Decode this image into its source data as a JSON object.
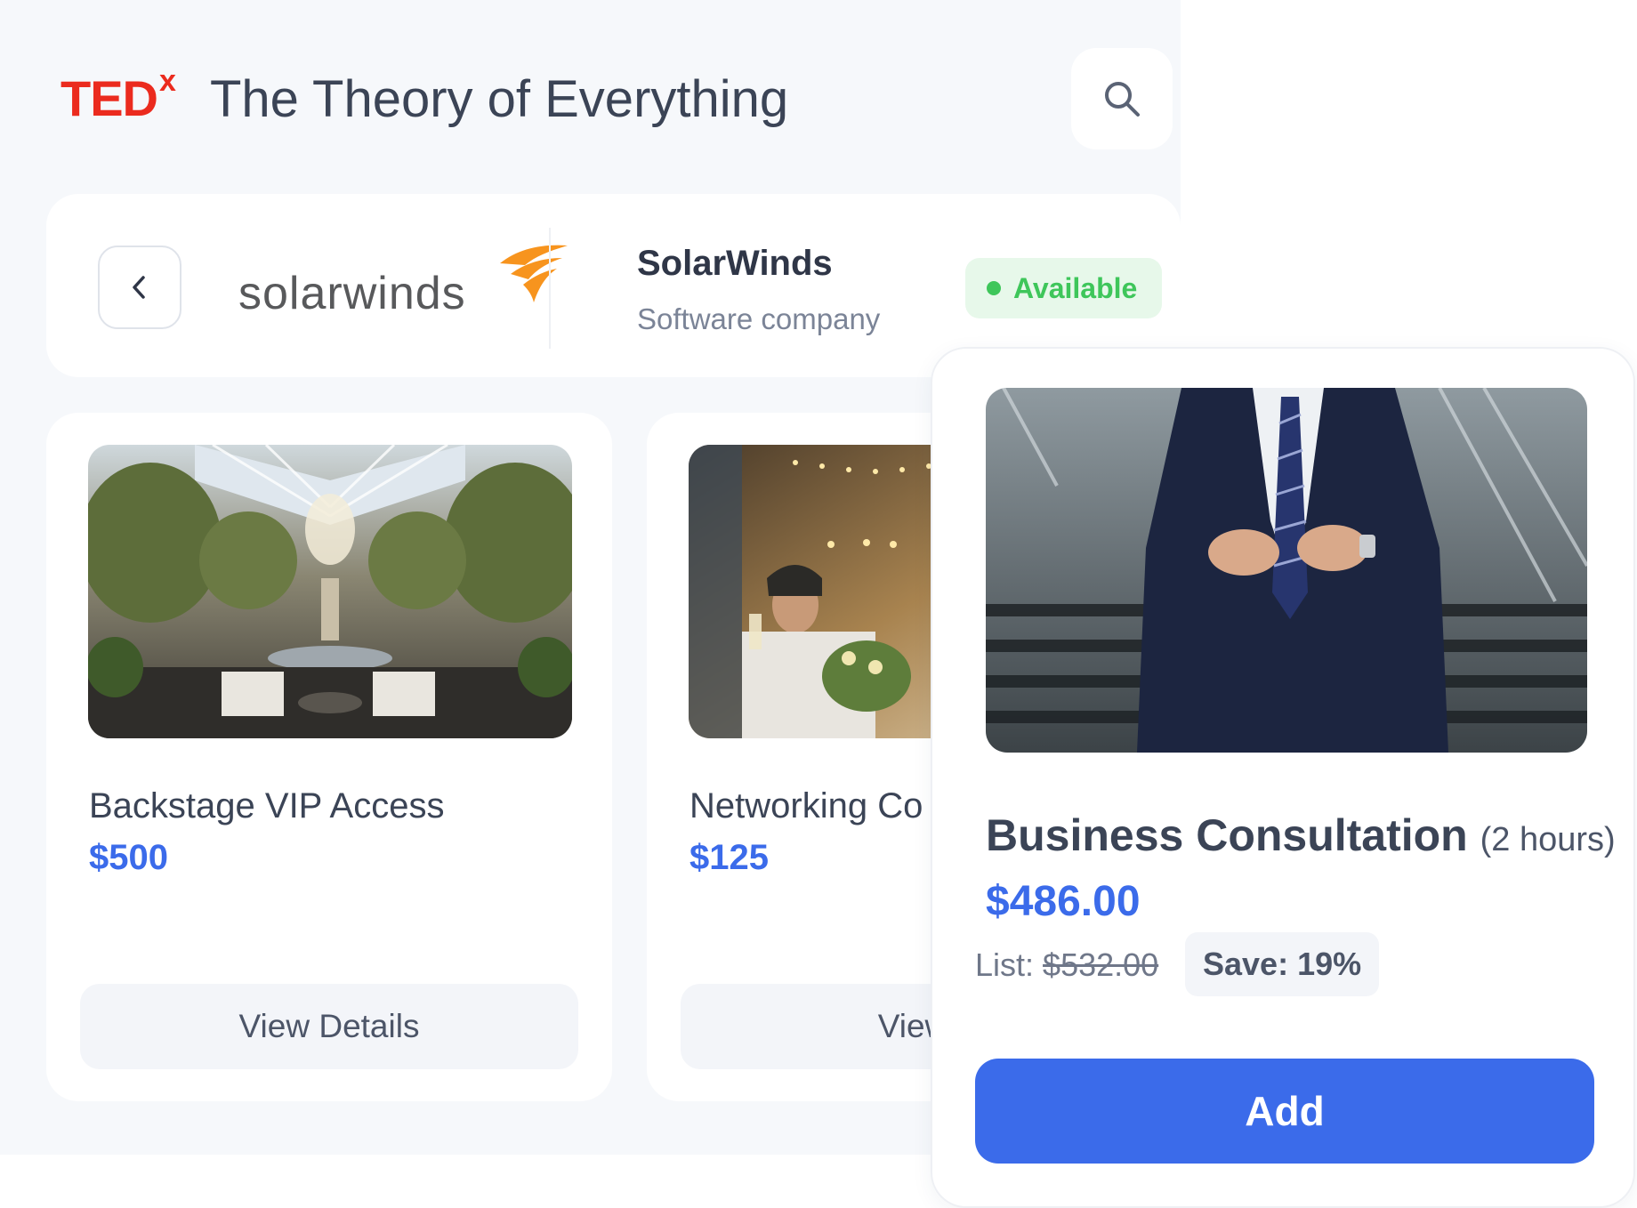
{
  "header": {
    "brand_main": "TED",
    "brand_sup": "x",
    "event_title": "The Theory of Everything",
    "search_icon": "search-icon"
  },
  "vendor": {
    "back_icon": "chevron-left-icon",
    "logo_text": "solarwinds",
    "name": "SolarWinds",
    "type": "Software company",
    "status": "Available",
    "status_color": "#3ec65a"
  },
  "products": [
    {
      "title": "Backstage VIP Access",
      "price": "$500",
      "button": "View Details"
    },
    {
      "title": "Networking Co",
      "price": "$125",
      "button": "View D"
    }
  ],
  "featured": {
    "title": "Business Consultation",
    "duration": "(2 hours)",
    "price": "$486.00",
    "list_label": "List:",
    "list_price": "$532.00",
    "save": "Save: 19%",
    "add_button": "Add"
  },
  "colors": {
    "accent": "#3b6bea",
    "brand_red": "#eb2b1e",
    "background": "#f6f8fb"
  }
}
